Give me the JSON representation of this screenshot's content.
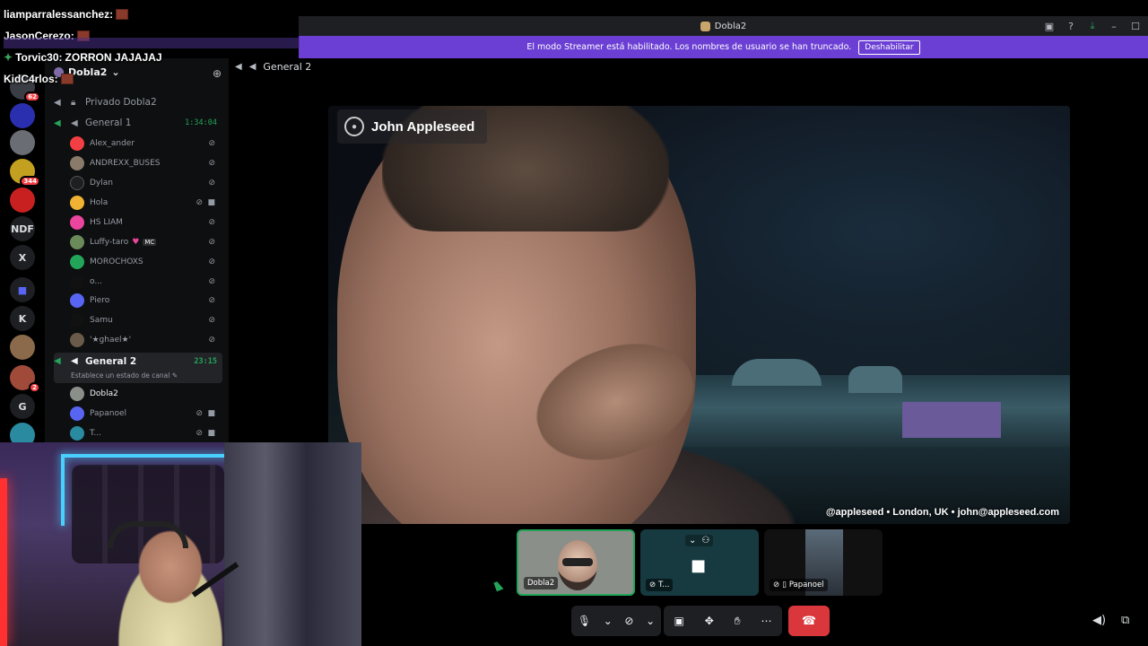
{
  "window": {
    "title": "Dobla2"
  },
  "banner": {
    "text": "El modo Streamer está habilitado. Los nombres de usuario se han truncado.",
    "button": "Deshabilitar"
  },
  "chat": [
    {
      "user": "liamparralessanchez:",
      "msg": ""
    },
    {
      "user": "JasonCerezo:",
      "msg": ""
    },
    {
      "user": "Torvic30:",
      "msg": "ZORRON JAJAJAJ"
    },
    {
      "user": "KidC4rlos:",
      "msg": ""
    }
  ],
  "rail": {
    "badge1": "62",
    "badge2": "344",
    "ndf": "NDF",
    "x": "X",
    "k": "K",
    "badge3": "2",
    "g": "G"
  },
  "server": {
    "name": "Dobla2"
  },
  "channels": {
    "private": "Privado Dobla2",
    "general1": {
      "name": "General 1",
      "time": "1:34:04"
    },
    "general2": {
      "name": "General 2",
      "time": "23:15",
      "status": "Establece un estado de canal"
    }
  },
  "users_g1": [
    "Alex_ander",
    "ANDREXX_BUSES",
    "Dylan",
    "Hola",
    "HS LIAM",
    "Luffy-taro",
    "MOROCHOXS",
    "o...",
    "Piero",
    "Samu",
    "'★ghael★'"
  ],
  "luffy_tag": "MC",
  "users_g2": [
    "Dobla2",
    "Papanoel",
    "T..."
  ],
  "voice_header": "General 2",
  "stream": {
    "name": "John Appleseed",
    "caption": "@appleseed • London, UK • john@appleseed.com"
  },
  "tiles": [
    {
      "label": "Dobla2"
    },
    {
      "label": "T..."
    },
    {
      "label": "Papanoel"
    }
  ],
  "colors": {
    "accent": "#6b3fd4",
    "green": "#23a559",
    "danger": "#da373c"
  }
}
